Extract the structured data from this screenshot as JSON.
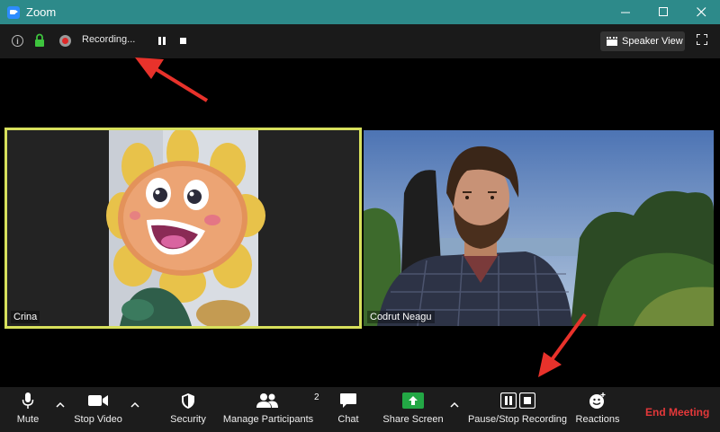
{
  "window": {
    "title": "Zoom",
    "minimize_icon": "minimize-icon",
    "maximize_icon": "maximize-icon",
    "close_icon": "close-icon"
  },
  "topbar": {
    "recording_label": "Recording...",
    "speaker_view_label": "Speaker View",
    "info_glyph": "i"
  },
  "participants": [
    {
      "name": "Crina"
    },
    {
      "name": "Codrut Neagu"
    }
  ],
  "toolbar": {
    "mute": "Mute",
    "stop_video": "Stop Video",
    "security": "Security",
    "manage_participants": "Manage Participants",
    "participant_count": "2",
    "chat": "Chat",
    "share_screen": "Share Screen",
    "pause_stop_recording": "Pause/Stop Recording",
    "reactions": "Reactions",
    "end_meeting": "End Meeting"
  },
  "colors": {
    "titlebar": "#2d8a8a",
    "active_speaker_border": "#d7e05c",
    "end_meeting": "#e4383a",
    "share_screen": "#23a745",
    "annotation_arrow": "#e8322b"
  }
}
